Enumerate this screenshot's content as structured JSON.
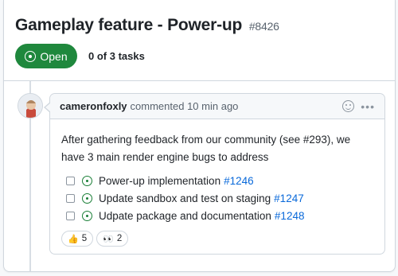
{
  "issue": {
    "title": "Gameplay feature - Power-up",
    "number": "#8426",
    "state": "Open",
    "tasks_summary": "0 of 3 tasks"
  },
  "comment": {
    "author": "cameronfoxly",
    "meta": "commented 10 min ago",
    "body": "After gathering feedback from our community (see #293), we have 3 main render engine bugs to address",
    "tasks": [
      {
        "label": "Power-up implementation",
        "ref": "#1246",
        "checked": false
      },
      {
        "label": "Update sandbox and test on staging",
        "ref": "#1247",
        "checked": false
      },
      {
        "label": "Udpate package and documentation",
        "ref": "#1248",
        "checked": false
      }
    ],
    "reactions": [
      {
        "emoji": "👍",
        "count": "5"
      },
      {
        "emoji": "👀",
        "count": "2"
      }
    ],
    "header_icons": [
      "smiley-icon",
      "kebab-menu-icon"
    ]
  },
  "colors": {
    "open_green": "#1f883d",
    "link_blue": "#0969da",
    "border": "#d0d7de"
  }
}
